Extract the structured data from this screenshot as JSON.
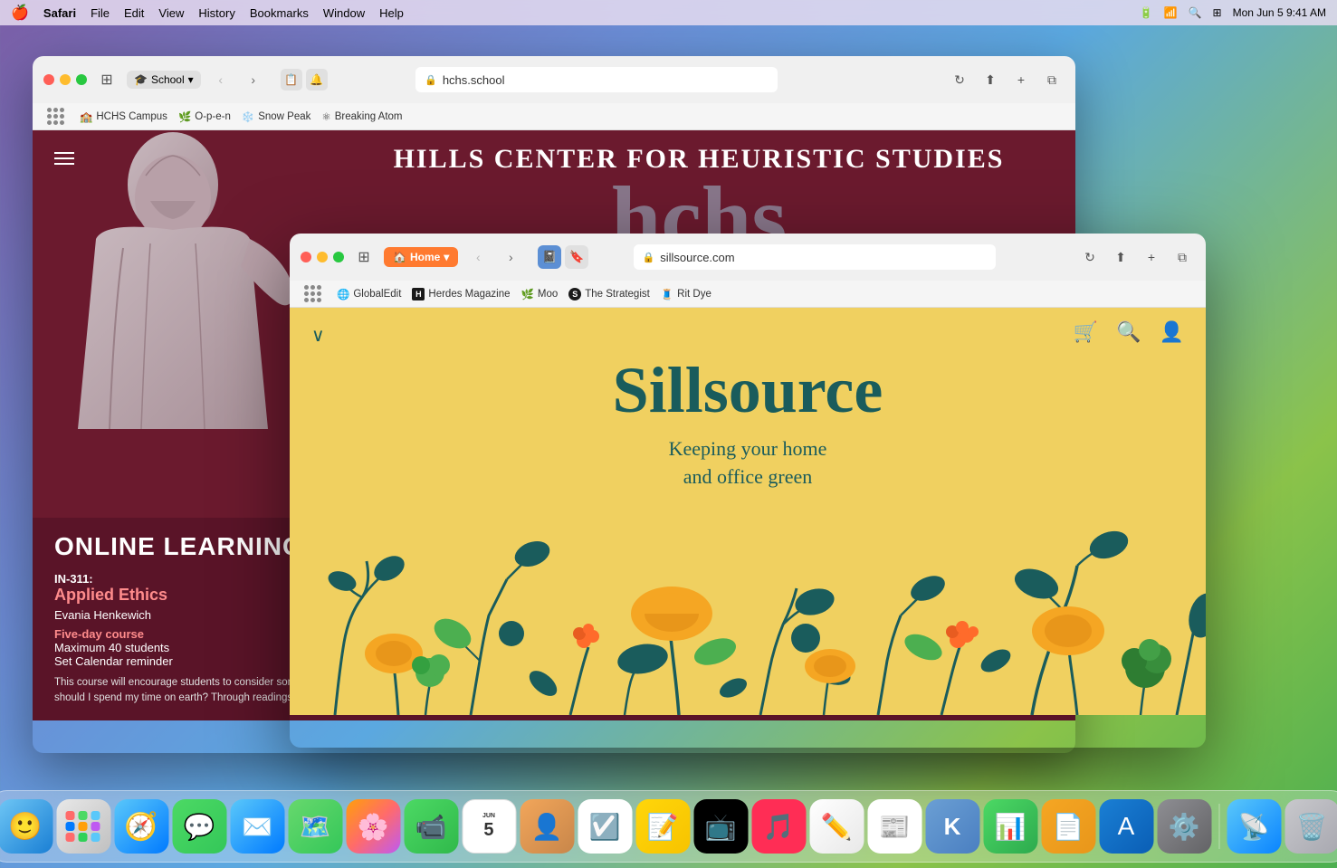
{
  "menubar": {
    "apple": "🍎",
    "app": "Safari",
    "menus": [
      "File",
      "Edit",
      "View",
      "History",
      "Bookmarks",
      "Window",
      "Help"
    ],
    "time": "9:41 AM",
    "date": "Mon Jun 5"
  },
  "window1": {
    "title": "HCHS",
    "url": "hchs.school",
    "tab_group": "School",
    "bookmarks": [
      {
        "icon": "🏫",
        "label": "HCHS Campus"
      },
      {
        "icon": "🌿",
        "label": "O-p-e-n"
      },
      {
        "icon": "❄️",
        "label": "Snow Peak"
      },
      {
        "icon": "⚛",
        "label": "Breaking Atom"
      }
    ],
    "header": "HILLS CENTER FOR HEURISTIC STUDIES",
    "big_letters": "hchs",
    "online_learning": "ONLINE LEARNING",
    "course": {
      "number": "IN-311:",
      "name": "Applied Ethics",
      "instructor": "Evania Henkewich",
      "link": "Five-day course",
      "detail1": "Maximum 40 students",
      "detail2": "Set Calendar reminder",
      "description": "This course will encourage students to consider some of the questions most fundamental to the human experience: What is right and what is wrong? Does context matter, or are some actions always immoral? How should I spend my time on earth? Through readings, in-class discussions, and a series of written assignments, students will be asked to engage with the ethical dimensions of"
    }
  },
  "window2": {
    "title": "Sillsource",
    "url": "sillsource.com",
    "tab_group": "Home",
    "bookmarks": [
      {
        "icon": "🌐",
        "label": "GlobalEdit"
      },
      {
        "icon": "H",
        "label": "Herdes Magazine"
      },
      {
        "icon": "🌿",
        "label": "Moo"
      },
      {
        "icon": "S",
        "label": "The Strategist"
      },
      {
        "icon": "🧵",
        "label": "Rit Dye"
      }
    ],
    "heading": "Sillsource",
    "subheading": "Keeping your home\nand office green"
  },
  "dock": {
    "items": [
      {
        "name": "Finder",
        "emoji": "😊",
        "type": "finder"
      },
      {
        "name": "Launchpad",
        "emoji": "⊞",
        "type": "launchpad"
      },
      {
        "name": "Safari",
        "emoji": "🧭",
        "type": "safari"
      },
      {
        "name": "Messages",
        "emoji": "💬",
        "type": "messages"
      },
      {
        "name": "Mail",
        "emoji": "✉️",
        "type": "mail"
      },
      {
        "name": "Maps",
        "emoji": "🗺️",
        "type": "maps"
      },
      {
        "name": "Photos",
        "emoji": "🌸",
        "type": "photos"
      },
      {
        "name": "FaceTime",
        "emoji": "📹",
        "type": "facetime"
      },
      {
        "name": "Calendar",
        "month": "JUN",
        "date": "5",
        "type": "calendar"
      },
      {
        "name": "Contacts",
        "emoji": "👤",
        "type": "contacts"
      },
      {
        "name": "Reminders",
        "emoji": "☑️",
        "type": "reminders"
      },
      {
        "name": "Notes",
        "emoji": "📝",
        "type": "notes"
      },
      {
        "name": "TV",
        "emoji": "📺",
        "type": "tv"
      },
      {
        "name": "Music",
        "emoji": "♪",
        "type": "music"
      },
      {
        "name": "Freeform",
        "emoji": "✏️",
        "type": "freeform"
      },
      {
        "name": "News",
        "emoji": "📰",
        "type": "news"
      },
      {
        "name": "Keynote",
        "emoji": "K",
        "type": "keynote"
      },
      {
        "name": "Numbers",
        "emoji": "N",
        "type": "numbers"
      },
      {
        "name": "Pages",
        "emoji": "P",
        "type": "pages"
      },
      {
        "name": "App Store",
        "emoji": "A",
        "type": "appstore"
      },
      {
        "name": "System Preferences",
        "emoji": "⚙️",
        "type": "syspreferences"
      },
      {
        "name": "AirDrop",
        "emoji": "📡",
        "type": "airdrop"
      },
      {
        "name": "Trash",
        "emoji": "🗑️",
        "type": "trash"
      }
    ],
    "calendar_month": "JUN",
    "calendar_date": "5"
  }
}
